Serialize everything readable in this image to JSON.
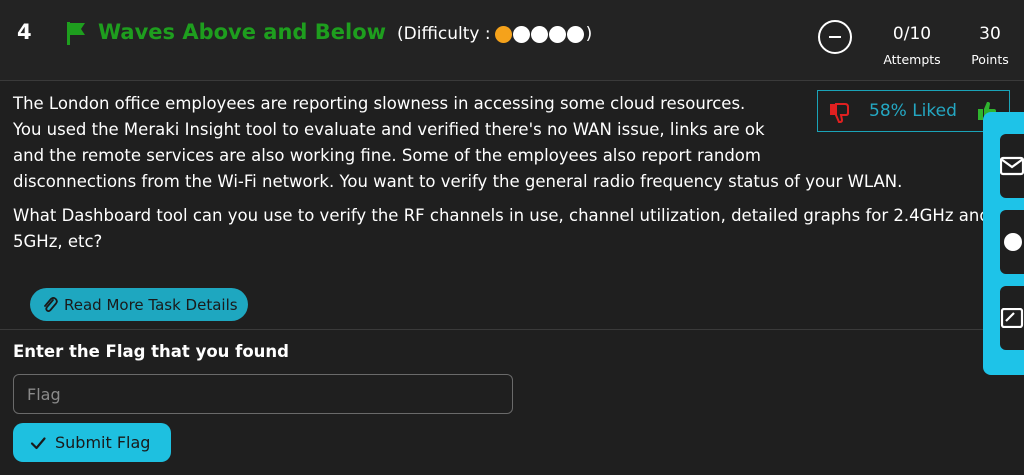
{
  "task": {
    "number": "4",
    "title": "Waves Above and Below",
    "difficulty_prefix": "(Difficulty :",
    "difficulty_suffix": ")",
    "difficulty_level": 1,
    "difficulty_max": 5
  },
  "stats": {
    "attempts_value": "0/10",
    "attempts_label": "Attempts",
    "points_value": "30",
    "points_label": "Points"
  },
  "feedback": {
    "liked_text": "58% Liked"
  },
  "description": {
    "paragraph1": "The London office employees are reporting slowness in accessing some cloud resources. You used the Meraki Insight tool to evaluate and verified there's no WAN issue, links are ok and the remote services are also working fine. Some of the employees also report random disconnections from the Wi-Fi network. You want to verify the general radio frequency status of your WLAN.",
    "paragraph2": "What Dashboard tool can you use to verify the RF channels in use, channel utilization, detailed graphs for 2.4GHz and 5GHz, etc?"
  },
  "read_more_label": "Read More Task Details",
  "flag_form": {
    "heading": "Enter the Flag that you found",
    "placeholder": "Flag",
    "value": "",
    "submit_label": "Submit Flag"
  },
  "colors": {
    "title_green": "#1e9e1e",
    "accent_cyan": "#1ec0e0",
    "difficulty_orange": "#f5a21b",
    "dislike_red": "#e02020",
    "like_green": "#2fb52f"
  },
  "side_panel": {
    "icons": [
      "mail-icon",
      "circle-icon",
      "note-icon"
    ]
  }
}
